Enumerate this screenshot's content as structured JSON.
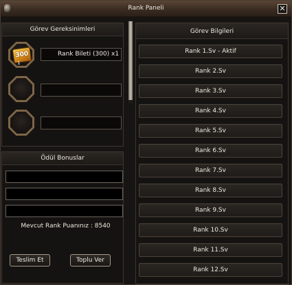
{
  "window": {
    "title": "Rank Paneli",
    "close_label": "✕"
  },
  "requirements": {
    "title": "Görev Gereksinimleri",
    "items": [
      {
        "badge": "300",
        "qty": "1",
        "label": "Rank Bileti (300) x1"
      },
      {
        "label": ""
      },
      {
        "label": ""
      }
    ]
  },
  "bonuses": {
    "title": "Ödül Bonuslar",
    "rows": [
      "",
      "",
      ""
    ],
    "points_text": "Mevcut Rank Puanınız : 8540",
    "deliver_label": "Teslim Et",
    "collect_label": "Toplu Ver"
  },
  "info": {
    "title": "Görev Bilgileri",
    "ranks": [
      "Rank 1.Sv - Aktif",
      "Rank 2.Sv",
      "Rank 3.Sv",
      "Rank 4.Sv",
      "Rank 5.Sv",
      "Rank 6.Sv",
      "Rank 7.Sv",
      "Rank 8.Sv",
      "Rank 9.Sv",
      "Rank 10.Sv",
      "Rank 11.Sv",
      "Rank 12.Sv"
    ]
  }
}
